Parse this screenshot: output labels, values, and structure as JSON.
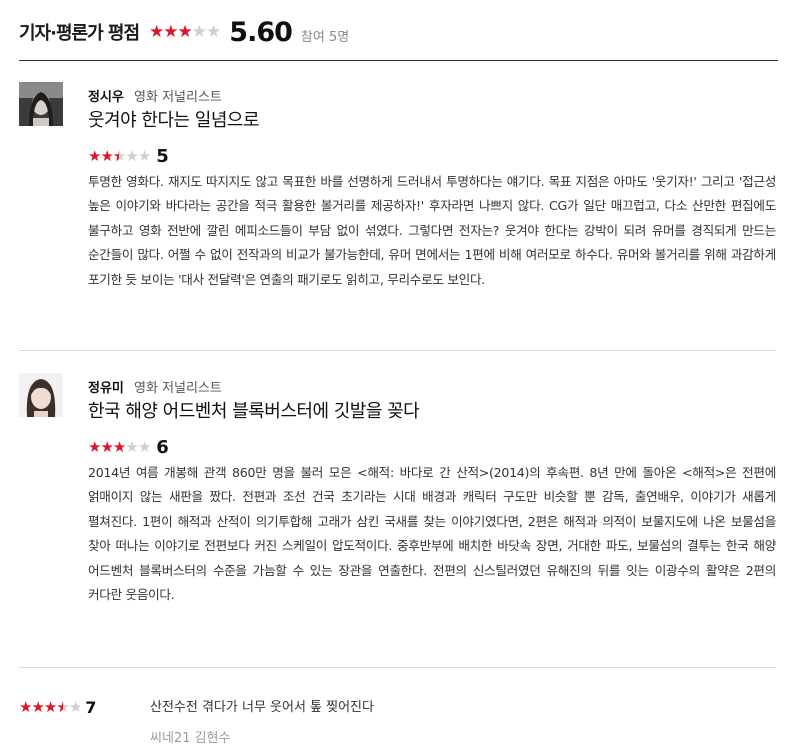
{
  "header": {
    "title": "기자·평론가 평점",
    "score": "5.60",
    "participants": "참여 5명",
    "stars": [
      "full",
      "full",
      "full",
      "empty",
      "empty"
    ]
  },
  "reviews": [
    {
      "author": "정시우",
      "role": "영화 저널리스트",
      "title": "웃겨야 한다는 일념으로",
      "rating": "5",
      "stars": [
        "full",
        "full",
        "half",
        "empty",
        "empty"
      ],
      "body": "투명한 영화다. 재지도 따지지도 않고 목표한 바를 선명하게 드러내서 투명하다는 얘기다. 목표 지점은 아마도 '웃기자!' 그리고 '접근성 높은 이야기와 바다라는 공간을 적극 활용한 볼거리를 제공하자!' 후자라면 나쁘지 않다. CG가 일단 매끄럽고, 다소 산만한 편집에도 불구하고 영화 전반에 깔린 에피소드들이 부담 없이 섞였다. 그렇다면 전자는? 웃겨야 한다는 강박이 되려 유머를 경직되게 만드는 순간들이 많다. 어쩔 수 없이 전작과의 비교가 불가능한데, 유머 면에서는 1편에 비해 여러모로 하수다. 유머와 볼거리를 위해 과감하게 포기한 듯 보이는 '대사 전달력'은 연출의 패기로도 읽히고, 무리수로도 보인다."
    },
    {
      "author": "정유미",
      "role": "영화 저널리스트",
      "title": "한국 해양 어드벤처 블록버스터에 깃발을 꽂다",
      "rating": "6",
      "stars": [
        "full",
        "full",
        "full",
        "empty",
        "empty"
      ],
      "body": "2014년 여름 개봉해 관객 860만 명을 불러 모은 <해적: 바다로 간 산적>(2014)의 후속편. 8년 만에 돌아온 <해적>은 전편에 얽매이지 않는 새판을 짰다. 전편과 조선 건국 초기라는 시대 배경과 캐릭터 구도만 비슷할 뿐 감독, 출연배우, 이야기가 새롭게 펼쳐진다. 1편이 해적과 산적이 의기투합해 고래가 삼킨 국새를 찾는 이야기였다면, 2편은 해적과 의적이 보물지도에 나온 보물섬을 찾아 떠나는 이야기로 전편보다 커진 스케일이 압도적이다. 중후반부에 배치한 바닷속 장면, 거대한 파도, 보물섬의 결투는 한국 해양 어드벤처 블록버스터의 수준을 가늠할 수 있는 장관을 연출한다. 전편의 신스틸러였던 유해진의 뒤를 잇는 이광수의 활약은 2편의 커다란 웃음이다."
    }
  ],
  "short_review": {
    "rating": "7",
    "stars": [
      "full",
      "full",
      "full",
      "half",
      "empty"
    ],
    "text": "산전수전 겪다가 너무 웃어서 톺 찢어진다",
    "author": "씨네21 김현수"
  },
  "colors": {
    "star_on": "#e0142b",
    "star_off": "#cfcfcf",
    "divider_strong": "#333333",
    "divider_light": "#dcdcdc"
  }
}
